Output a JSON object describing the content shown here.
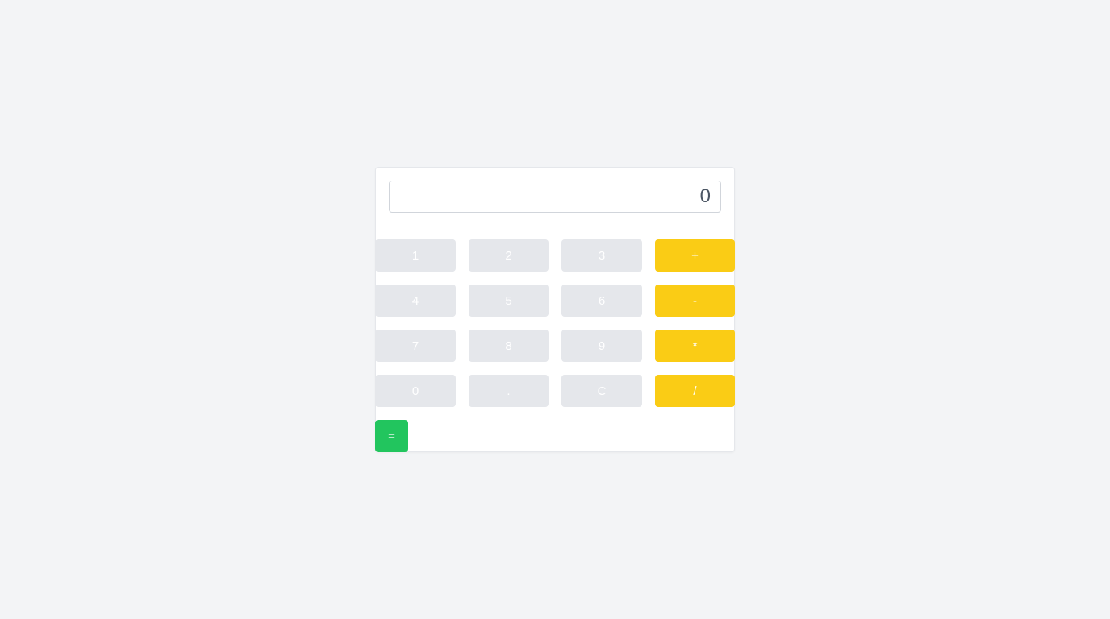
{
  "display": {
    "value": "0"
  },
  "rows": [
    {
      "keys": [
        {
          "label": "1"
        },
        {
          "label": "2"
        },
        {
          "label": "3"
        },
        {
          "label": "+"
        }
      ]
    },
    {
      "keys": [
        {
          "label": "4"
        },
        {
          "label": "5"
        },
        {
          "label": "6"
        },
        {
          "label": "-"
        }
      ]
    },
    {
      "keys": [
        {
          "label": "7"
        },
        {
          "label": "8"
        },
        {
          "label": "9"
        },
        {
          "label": "*"
        }
      ]
    },
    {
      "keys": [
        {
          "label": "0"
        },
        {
          "label": "."
        },
        {
          "label": "C"
        },
        {
          "label": "/"
        }
      ]
    }
  ],
  "equals": {
    "label": "="
  },
  "colors": {
    "background": "#f3f4f6",
    "number_key": "#e5e7eb",
    "operator_key": "#facc15",
    "equals_key": "#22c55e",
    "key_text": "#ffffff"
  }
}
